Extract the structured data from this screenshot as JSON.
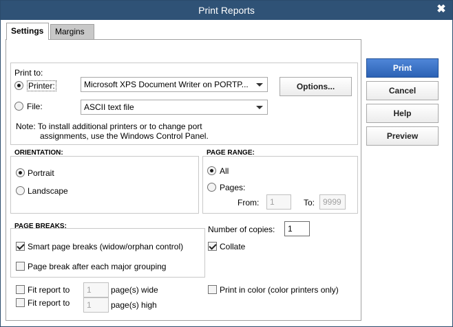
{
  "window": {
    "title": "Print Reports",
    "close_glyph": "✖"
  },
  "tabs": {
    "settings": "Settings",
    "margins": "Margins"
  },
  "print_to": {
    "heading": "Print to:",
    "printer_label": "Printer:",
    "printer_value": "Microsoft XPS Document Writer on PORTP...",
    "file_label": "File:",
    "file_value": "ASCII text file",
    "options_button": "Options...",
    "note_line1": "Note: To install additional printers or to change port",
    "note_line2": "assignments, use the Windows Control Panel."
  },
  "orientation": {
    "heading": "ORIENTATION:",
    "portrait": "Portrait",
    "landscape": "Landscape"
  },
  "page_range": {
    "heading": "PAGE RANGE:",
    "all": "All",
    "pages": "Pages:",
    "from_label": "From:",
    "from_value": "1",
    "to_label": "To:",
    "to_value": "9999"
  },
  "page_breaks": {
    "heading": "PAGE BREAKS:",
    "smart": "Smart page breaks (widow/orphan control)",
    "major": "Page break after each major grouping"
  },
  "copies": {
    "label": "Number of copies:",
    "value": "1",
    "collate": "Collate"
  },
  "fit": {
    "fit_wide": "Fit report to",
    "wide_value": "1",
    "wide_suffix": "page(s) wide",
    "fit_high": "Fit report to",
    "high_value": "1",
    "high_suffix": "page(s) high"
  },
  "color_option": "Print in color (color printers only)",
  "buttons": {
    "print": "Print",
    "cancel": "Cancel",
    "help": "Help",
    "preview": "Preview"
  },
  "colors": {
    "titlebar": "#2f5276",
    "primary_button": "#2c62b5"
  }
}
